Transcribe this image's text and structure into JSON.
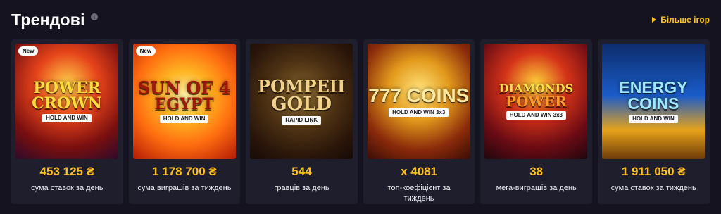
{
  "header": {
    "title": "Трендові",
    "info_icon": "info-icon",
    "more_label": "Більше ігор",
    "more_icon": "play-icon",
    "accent": "#ffc21a"
  },
  "cards": [
    {
      "badge": "New",
      "logo": [
        "POWER",
        "CROWN",
        "HOLD AND WIN"
      ],
      "stat": "453 125 ₴",
      "desc": "сума ставок за день"
    },
    {
      "badge": "New",
      "logo": [
        "SUN OF 4",
        "EGYPT",
        "HOLD AND WIN"
      ],
      "stat": "1 178 700 ₴",
      "desc": "сума виграшів за тиждень"
    },
    {
      "badge": "",
      "logo": [
        "POMPEII",
        "GOLD",
        "RAPID LINK"
      ],
      "stat": "544",
      "desc": "гравців за день"
    },
    {
      "badge": "",
      "logo": [
        "777 COINS",
        "",
        "HOLD AND WIN 3x3"
      ],
      "stat": "x 4081",
      "desc": "топ-коефіцієнт за тиждень"
    },
    {
      "badge": "",
      "logo": [
        "DIAMONDS",
        "POWER",
        "HOLD AND WIN 3x3"
      ],
      "stat": "38",
      "desc": "мега-виграшів за день"
    },
    {
      "badge": "",
      "logo": [
        "ENERGY",
        "COINS",
        "HOLD AND WIN"
      ],
      "stat": "1 911 050 ₴",
      "desc": "сума ставок за тиждень"
    }
  ]
}
